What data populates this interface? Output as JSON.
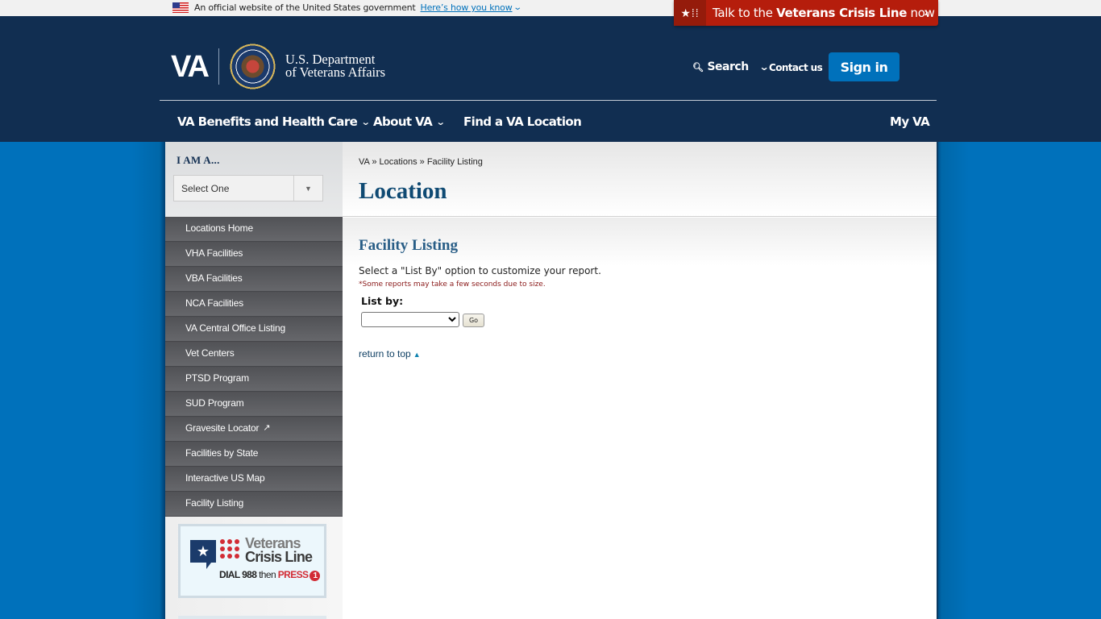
{
  "gov_banner": {
    "text": "An official website of the United States government",
    "link": "Here’s how you know"
  },
  "crisis_line": {
    "prefix": "Talk to the ",
    "bold": "Veterans Crisis Line",
    "suffix": " now"
  },
  "header": {
    "logo_text": "VA",
    "dept_line1": "U.S. Department",
    "dept_line2": "of Veterans Affairs",
    "search_label": "Search",
    "contact_label": "Contact us",
    "signin_label": "Sign in"
  },
  "nav": {
    "items": [
      {
        "label": "VA Benefits and Health Care",
        "has_dropdown": true
      },
      {
        "label": "About VA",
        "has_dropdown": true
      },
      {
        "label": "Find a VA Location",
        "has_dropdown": false
      }
    ],
    "my_va": "My VA"
  },
  "sidebar": {
    "iam_label": "I AM A...",
    "iam_select_value": "Select One",
    "items": [
      {
        "label": "Locations Home"
      },
      {
        "label": "VHA Facilities"
      },
      {
        "label": "VBA Facilities"
      },
      {
        "label": "NCA Facilities"
      },
      {
        "label": "VA Central Office Listing"
      },
      {
        "label": "Vet Centers"
      },
      {
        "label": "PTSD Program"
      },
      {
        "label": "SUD Program"
      },
      {
        "label": "Gravesite Locator",
        "external": true
      },
      {
        "label": "Facilities by State"
      },
      {
        "label": "Interactive US Map"
      },
      {
        "label": "Facility Listing"
      }
    ],
    "crisis_promo": {
      "line1": "Veterans",
      "line2": "Crisis Line",
      "dial": "DIAL 988",
      "then": " then ",
      "press": "PRESS",
      "number": "1"
    }
  },
  "main": {
    "breadcrumb": [
      "VA",
      "Locations",
      "Facility Listing"
    ],
    "breadcrumb_sep": " » ",
    "page_title": "Location",
    "section_title": "Facility Listing",
    "intro": "Select a \"List By\" option to customize your report.",
    "note": "*Some reports may take a few seconds due to size.",
    "list_by_label": "List by:",
    "list_by_value": "",
    "go_label": "Go",
    "return_to_top": "return to top"
  },
  "colors": {
    "header_bg": "#112e51",
    "page_bg": "#0071bb",
    "crisis_red": "#b51d0c",
    "signin_blue": "#0071bb",
    "title_blue": "#0f4a73"
  }
}
